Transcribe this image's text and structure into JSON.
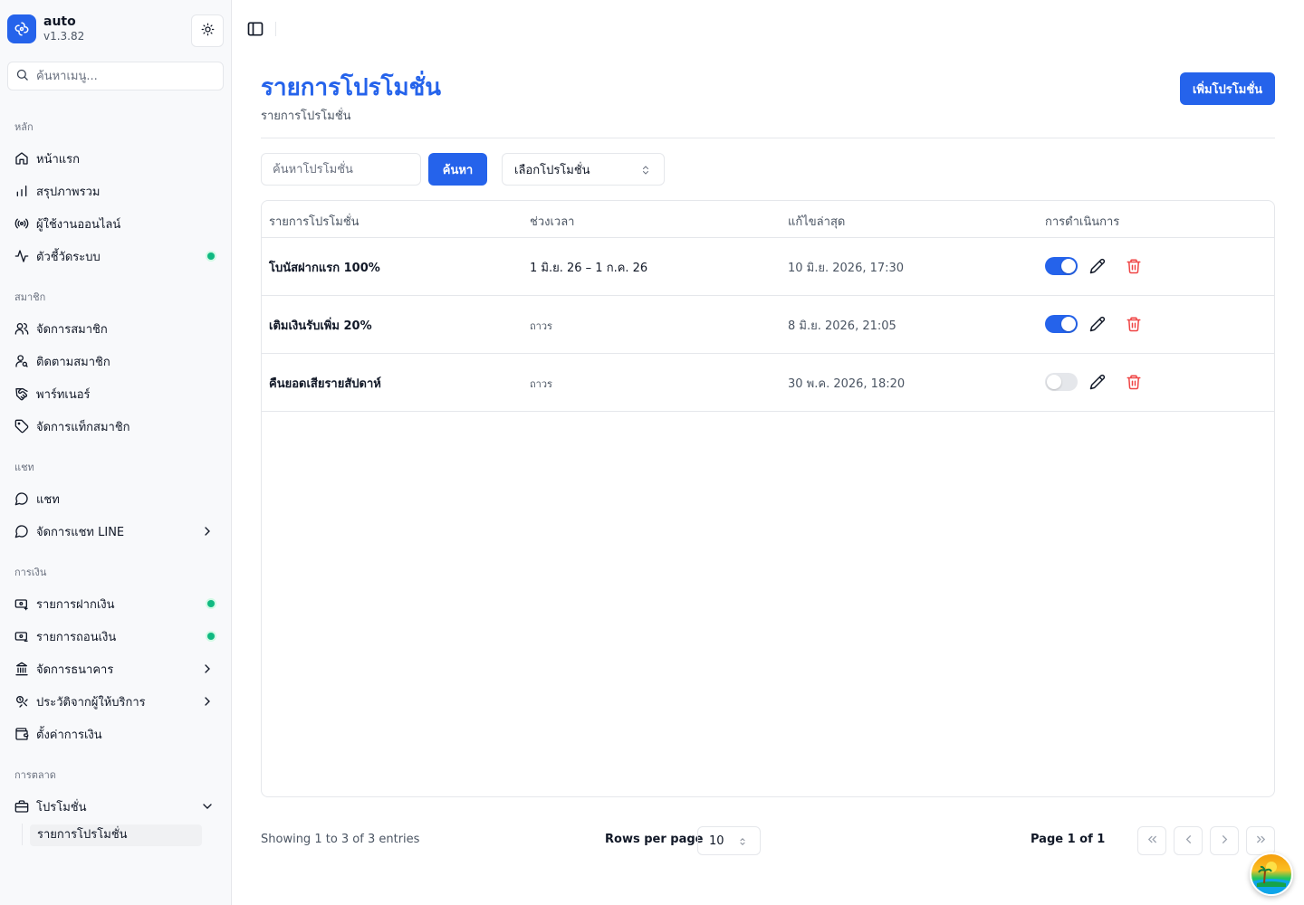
{
  "app": {
    "name": "auto",
    "version": "v1.3.82"
  },
  "sidebar": {
    "search_placeholder": "ค้นหาเมนู...",
    "groups": [
      {
        "label": "หลัก",
        "items": [
          {
            "label": "หน้าแรก",
            "icon": "home-icon"
          },
          {
            "label": "สรุปภาพรวม",
            "icon": "bar-chart-icon"
          },
          {
            "label": "ผู้ใช้งานออนไลน์",
            "icon": "radio-icon"
          },
          {
            "label": "ตัวชี้วัดระบบ",
            "icon": "activity-icon",
            "dot": true
          }
        ]
      },
      {
        "label": "สมาชิก",
        "items": [
          {
            "label": "จัดการสมาชิก",
            "icon": "users-icon"
          },
          {
            "label": "ติดตามสมาชิก",
            "icon": "user-search-icon"
          },
          {
            "label": "พาร์ทเนอร์",
            "icon": "handshake-icon"
          },
          {
            "label": "จัดการแท็กสมาชิก",
            "icon": "tag-icon"
          }
        ]
      },
      {
        "label": "แชท",
        "items": [
          {
            "label": "แชท",
            "icon": "chat-bubble-icon"
          },
          {
            "label": "จัดการแชท LINE",
            "icon": "chat-bubble-icon",
            "chevron": true
          }
        ]
      },
      {
        "label": "การเงิน",
        "items": [
          {
            "label": "รายการฝากเงิน",
            "icon": "deposit-icon",
            "dot": true
          },
          {
            "label": "รายการถอนเงิน",
            "icon": "withdraw-icon",
            "dot": true
          },
          {
            "label": "จัดการธนาคาร",
            "icon": "bank-icon",
            "chevron": true
          },
          {
            "label": "ประวัติจากผู้ให้บริการ",
            "icon": "history-icon",
            "chevron": true
          },
          {
            "label": "ตั้งค่าการเงิน",
            "icon": "wallet-icon"
          }
        ]
      },
      {
        "label": "การตลาด",
        "items": [
          {
            "label": "โปรโมชั่น",
            "icon": "briefcase-icon",
            "expanded": true
          }
        ]
      }
    ],
    "sub_item": "รายการโปรโมชั่น"
  },
  "header": {
    "title": "รายการโปรโมชั่น",
    "subtitle": "รายการโปรโมชั่น",
    "add_button": "เพิ่มโปรโมชั่น"
  },
  "filters": {
    "search_placeholder": "ค้นหาโปรโมชั่น",
    "search_button": "ค้นหา",
    "select_value": "เลือกโปรโมชั่น"
  },
  "table": {
    "columns": [
      "รายการโปรโมชั่น",
      "ช่วงเวลา",
      "แก้ไขล่าสุด",
      "การดำเนินการ"
    ],
    "rows": [
      {
        "name": "โบนัสฝากแรก 100%",
        "period": "1 มิ.ย. 26 – 1 ก.ค. 26",
        "updated": "10 มิ.ย. 2026, 17:30",
        "active": true
      },
      {
        "name": "เติมเงินรับเพิ่ม 20%",
        "period": "ถาวร",
        "updated": "8 มิ.ย. 2026, 21:05",
        "active": true
      },
      {
        "name": "คืนยอดเสียรายสัปดาห์",
        "period": "ถาวร",
        "updated": "30 พ.ค. 2026, 18:20",
        "active": false
      }
    ]
  },
  "footer": {
    "showing": "Showing 1 to 3 of 3 entries",
    "rows_per_page_label": "Rows per page",
    "rows_per_page_value": "10",
    "page_info": "Page 1 of 1"
  },
  "colors": {
    "accent": "#2563eb",
    "status_dot": "#10b981",
    "danger": "#ef4444"
  }
}
